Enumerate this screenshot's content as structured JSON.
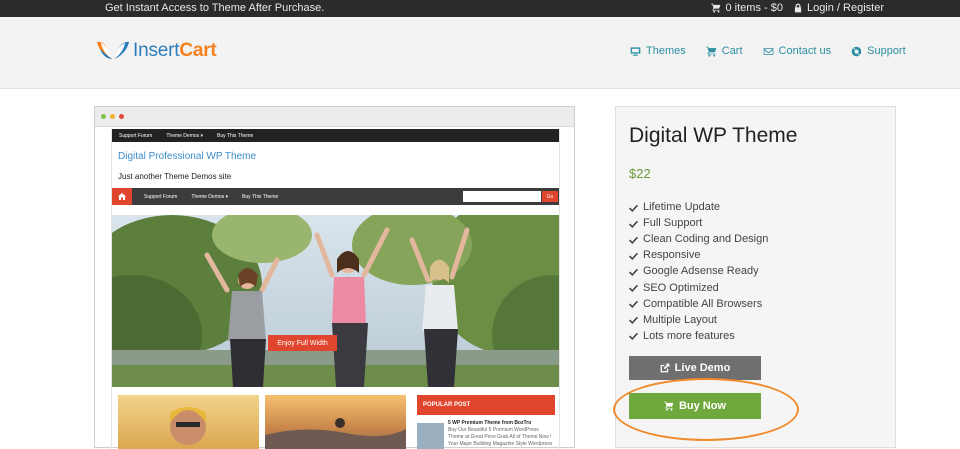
{
  "topbar": {
    "message": "Get Instant Access to Theme After Purchase.",
    "cart": "0 items - $0",
    "login": "Login / Register"
  },
  "header": {
    "logo": {
      "part1": "Insert",
      "part2": "Cart"
    },
    "nav": [
      {
        "label": "Themes",
        "icon": "monitor-icon"
      },
      {
        "label": "Cart",
        "icon": "cart-icon"
      },
      {
        "label": "Contact us",
        "icon": "envelope-icon"
      },
      {
        "label": "Support",
        "icon": "lifebuoy-icon"
      }
    ]
  },
  "preview": {
    "mini_nav": [
      "Support Forum",
      "Theme Demos ▾",
      "Buy This Theme"
    ],
    "site_title": "Digital Professional WP Theme",
    "tagline": "Just another Theme Demos site",
    "main_nav": [
      "Support Forum",
      "Theme Demos ▾",
      "Buy This Theme"
    ],
    "search_go": "Go",
    "hero_button": "Enjoy Full Width",
    "popular_heading": "POPULAR POST",
    "popular_title": "5 WP Premium Theme from BozTro",
    "popular_desc": "Buy Our Beautiful 5 Premium WordPress Theme at Great Price Grab All of Theme Now ! Your Major Building Magazine Style Wordpress"
  },
  "product": {
    "title": "Digital WP Theme",
    "price": "$22",
    "features": [
      "Lifetime Update",
      "Full Support",
      "Clean Coding and Design",
      "Responsive",
      "Google Adsense Ready",
      "SEO Optimized",
      "Compatible All Browsers",
      "Multiple Layout",
      "Lots more features"
    ],
    "live_demo": "Live Demo",
    "buy_now": "Buy Now"
  },
  "colors": {
    "accent": "#2a8fa0",
    "buy": "#6fa83c",
    "demo": "#6f6f6f",
    "highlight": "#f08a2a",
    "preview_red": "#e0452e"
  }
}
